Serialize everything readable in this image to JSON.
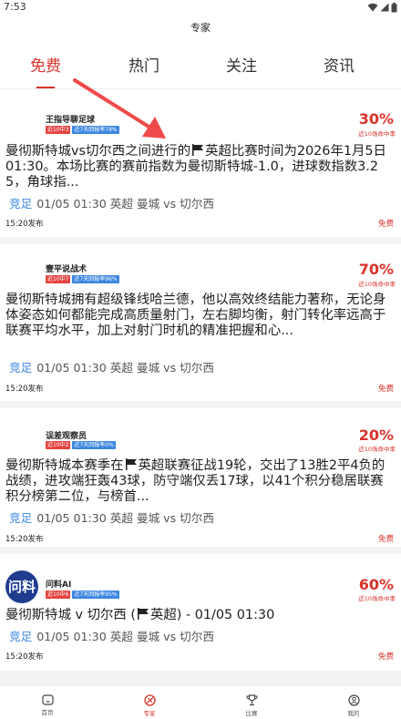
{
  "status_bar": {
    "time": "7:53"
  },
  "header": {
    "title": "专家"
  },
  "tabs": [
    {
      "label": "免费",
      "active": true
    },
    {
      "label": "热门",
      "active": false
    },
    {
      "label": "关注",
      "active": false
    },
    {
      "label": "资讯",
      "active": false
    }
  ],
  "accent_color": "#d9342b",
  "cards": [
    {
      "author": "王指导聊足球",
      "tags": [
        "近10中3",
        "近7天回报率78%"
      ],
      "rate": "30%",
      "rate_label": "近10场命中率",
      "text_before_flag": "曼彻斯特城vs切尔西之间进行的",
      "text_after_flag": "英超比赛时间为2026年1月5日 01:30。本场比赛的赛前指数为曼彻斯特城-1.0，进球数指数3.25，角球指...",
      "match_type": "竞足",
      "match": "01/05 01:30 英超 曼城 vs 切尔西",
      "time": "15:20发布",
      "price": "免费"
    },
    {
      "author": "壹平说战术",
      "tags": [
        "近10中7",
        "近7天回报率96%"
      ],
      "rate": "70%",
      "rate_label": "近10场命中率",
      "text": "曼彻斯特城拥有超级锋线哈兰德，他以高效终结能力著称，无论身体姿态如何都能完成高质量射门，左右脚均衡，射门转化率远高于联赛平均水平，加上对射门时机的精准把握和心...",
      "match_type": "竞足",
      "match": "01/05 01:30 英超 曼城 vs 切尔西",
      "time": "15:20发布",
      "price": "免费"
    },
    {
      "author": "误差观察员",
      "tags": [
        "近10中2",
        "近7天回报率0%"
      ],
      "rate": "20%",
      "rate_label": "近10场命中率",
      "text_before_flag": "曼彻斯特城本赛季在",
      "text_after_flag": "英超联赛征战19轮，交出了13胜2平4负的战绩，进攻端狂轰43球，防守端仅丢17球，以41个积分稳居联赛积分榜第二位，与榜首...",
      "match_type": "竞足",
      "match": "01/05 01:30 英超 曼城 vs 切尔西",
      "time": "15:20发布",
      "price": "免费"
    },
    {
      "author": "问料AI",
      "avatar_text": "问料",
      "tags": [
        "近10中6",
        "近7天回报率95%"
      ],
      "rate": "60%",
      "rate_label": "近10场命中率",
      "text_before_flag": "曼彻斯特城 v 切尔西 (",
      "text_after_flag": "英超) -  01/05 01:30",
      "match_type": "竞足",
      "match": "01/05 01:30 英超 曼城 vs 切尔西",
      "time": "15:20发布",
      "price": "免费"
    }
  ],
  "bottom_nav": [
    {
      "label": "首页",
      "icon": "home-icon",
      "active": false
    },
    {
      "label": "专家",
      "icon": "expert-icon",
      "active": true
    },
    {
      "label": "比赛",
      "icon": "trophy-icon",
      "active": false
    },
    {
      "label": "我的",
      "icon": "profile-icon",
      "active": false
    }
  ]
}
